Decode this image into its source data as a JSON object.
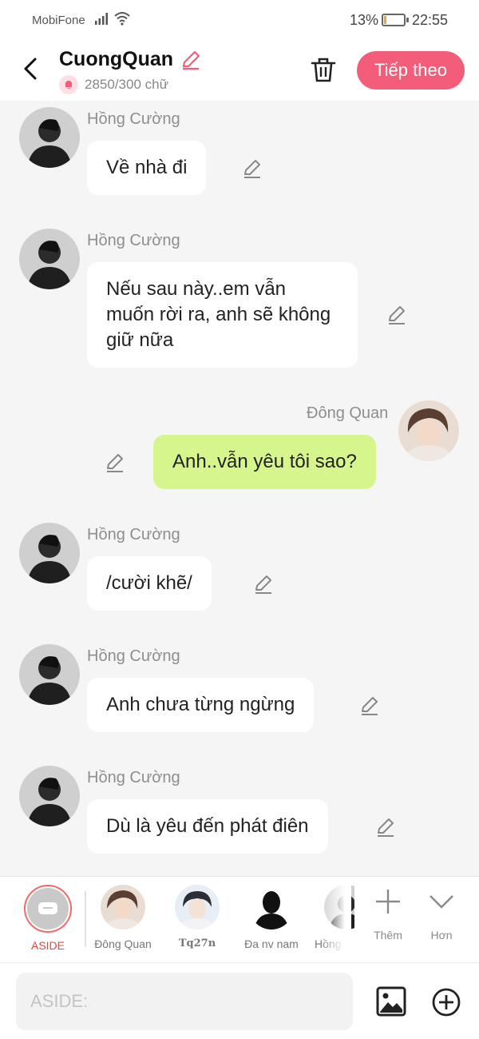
{
  "status_bar": {
    "carrier": "MobiFone",
    "battery": "13%",
    "battery_level": 0.13,
    "time": "22:55"
  },
  "header": {
    "title": "CuongQuan",
    "word_count": "2850/300 chữ",
    "next_button": "Tiếp theo",
    "accent_color": "#f45d7a"
  },
  "messages": [
    {
      "sender": "Hồng Cường",
      "side": "left",
      "text": "Về nhà đi"
    },
    {
      "sender": "Hồng Cường",
      "side": "left",
      "text": "Nếu sau này..em vẫn muốn rời ra, anh sẽ không giữ nữa"
    },
    {
      "sender": "Đông Quan",
      "side": "right",
      "text": "Anh..vẫn yêu tôi sao?"
    },
    {
      "sender": "Hồng Cường",
      "side": "left",
      "text": "/cười khẽ/"
    },
    {
      "sender": "Hồng Cường",
      "side": "left",
      "text": "Anh chưa từng ngừng"
    },
    {
      "sender": "Hồng Cường",
      "side": "left",
      "text": "Dù là yêu đến phát điên"
    }
  ],
  "characters": {
    "aside": "ASIDE",
    "items": [
      {
        "name": "Đông Quan"
      },
      {
        "name": "Tq27n"
      },
      {
        "name": "Đa nv nam"
      },
      {
        "name": "Hồng"
      }
    ],
    "add_label": "Thêm",
    "more_label": "Hơn"
  },
  "input": {
    "placeholder": "ASIDE:",
    "value": ""
  },
  "colors": {
    "my_bubble": "#d6f58c",
    "aside_accent": "#e8453c"
  }
}
